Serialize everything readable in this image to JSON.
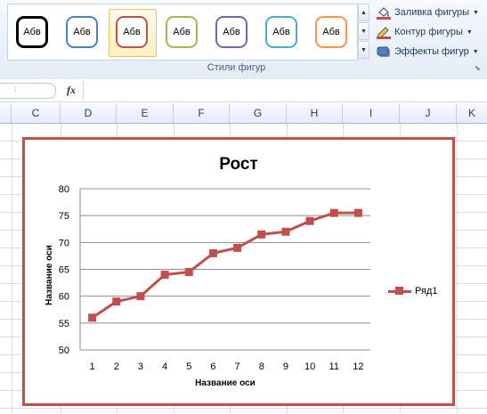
{
  "ribbon": {
    "shape_styles": [
      {
        "label": "Абв",
        "color": "#000000"
      },
      {
        "label": "Абв",
        "color": "#4f81bd"
      },
      {
        "label": "Абв",
        "color": "#c0504d"
      },
      {
        "label": "Абв",
        "color": "#9bbb59"
      },
      {
        "label": "Абв",
        "color": "#8064a2"
      },
      {
        "label": "Абв",
        "color": "#4bacc6"
      },
      {
        "label": "Абв",
        "color": "#f79646"
      }
    ],
    "selected_style_index": 2,
    "group_label": "Стили фигур",
    "fill_label": "Заливка фигуры",
    "outline_label": "Контур фигуры",
    "effects_label": "Эффекты фигур"
  },
  "formula_bar": {
    "fx_label": "fx",
    "value": ""
  },
  "columns": [
    "C",
    "D",
    "E",
    "F",
    "G",
    "H",
    "I",
    "J",
    "K"
  ],
  "chart_data": {
    "type": "line",
    "title": "Рост",
    "xlabel": "Название оси",
    "ylabel": "Название оси",
    "categories": [
      "1",
      "2",
      "3",
      "4",
      "5",
      "6",
      "7",
      "8",
      "9",
      "10",
      "11",
      "12"
    ],
    "series": [
      {
        "name": "Ряд1",
        "values": [
          56,
          59,
          60,
          64,
          64.5,
          68,
          69,
          71.5,
          72,
          74,
          75.5,
          75.5
        ],
        "color": "#c0504d"
      }
    ],
    "ylim": [
      50,
      80
    ],
    "yticks": [
      "50",
      "55",
      "60",
      "65",
      "70",
      "75",
      "80"
    ],
    "grid": true,
    "legend": "right",
    "border_color": "#c0504d"
  }
}
